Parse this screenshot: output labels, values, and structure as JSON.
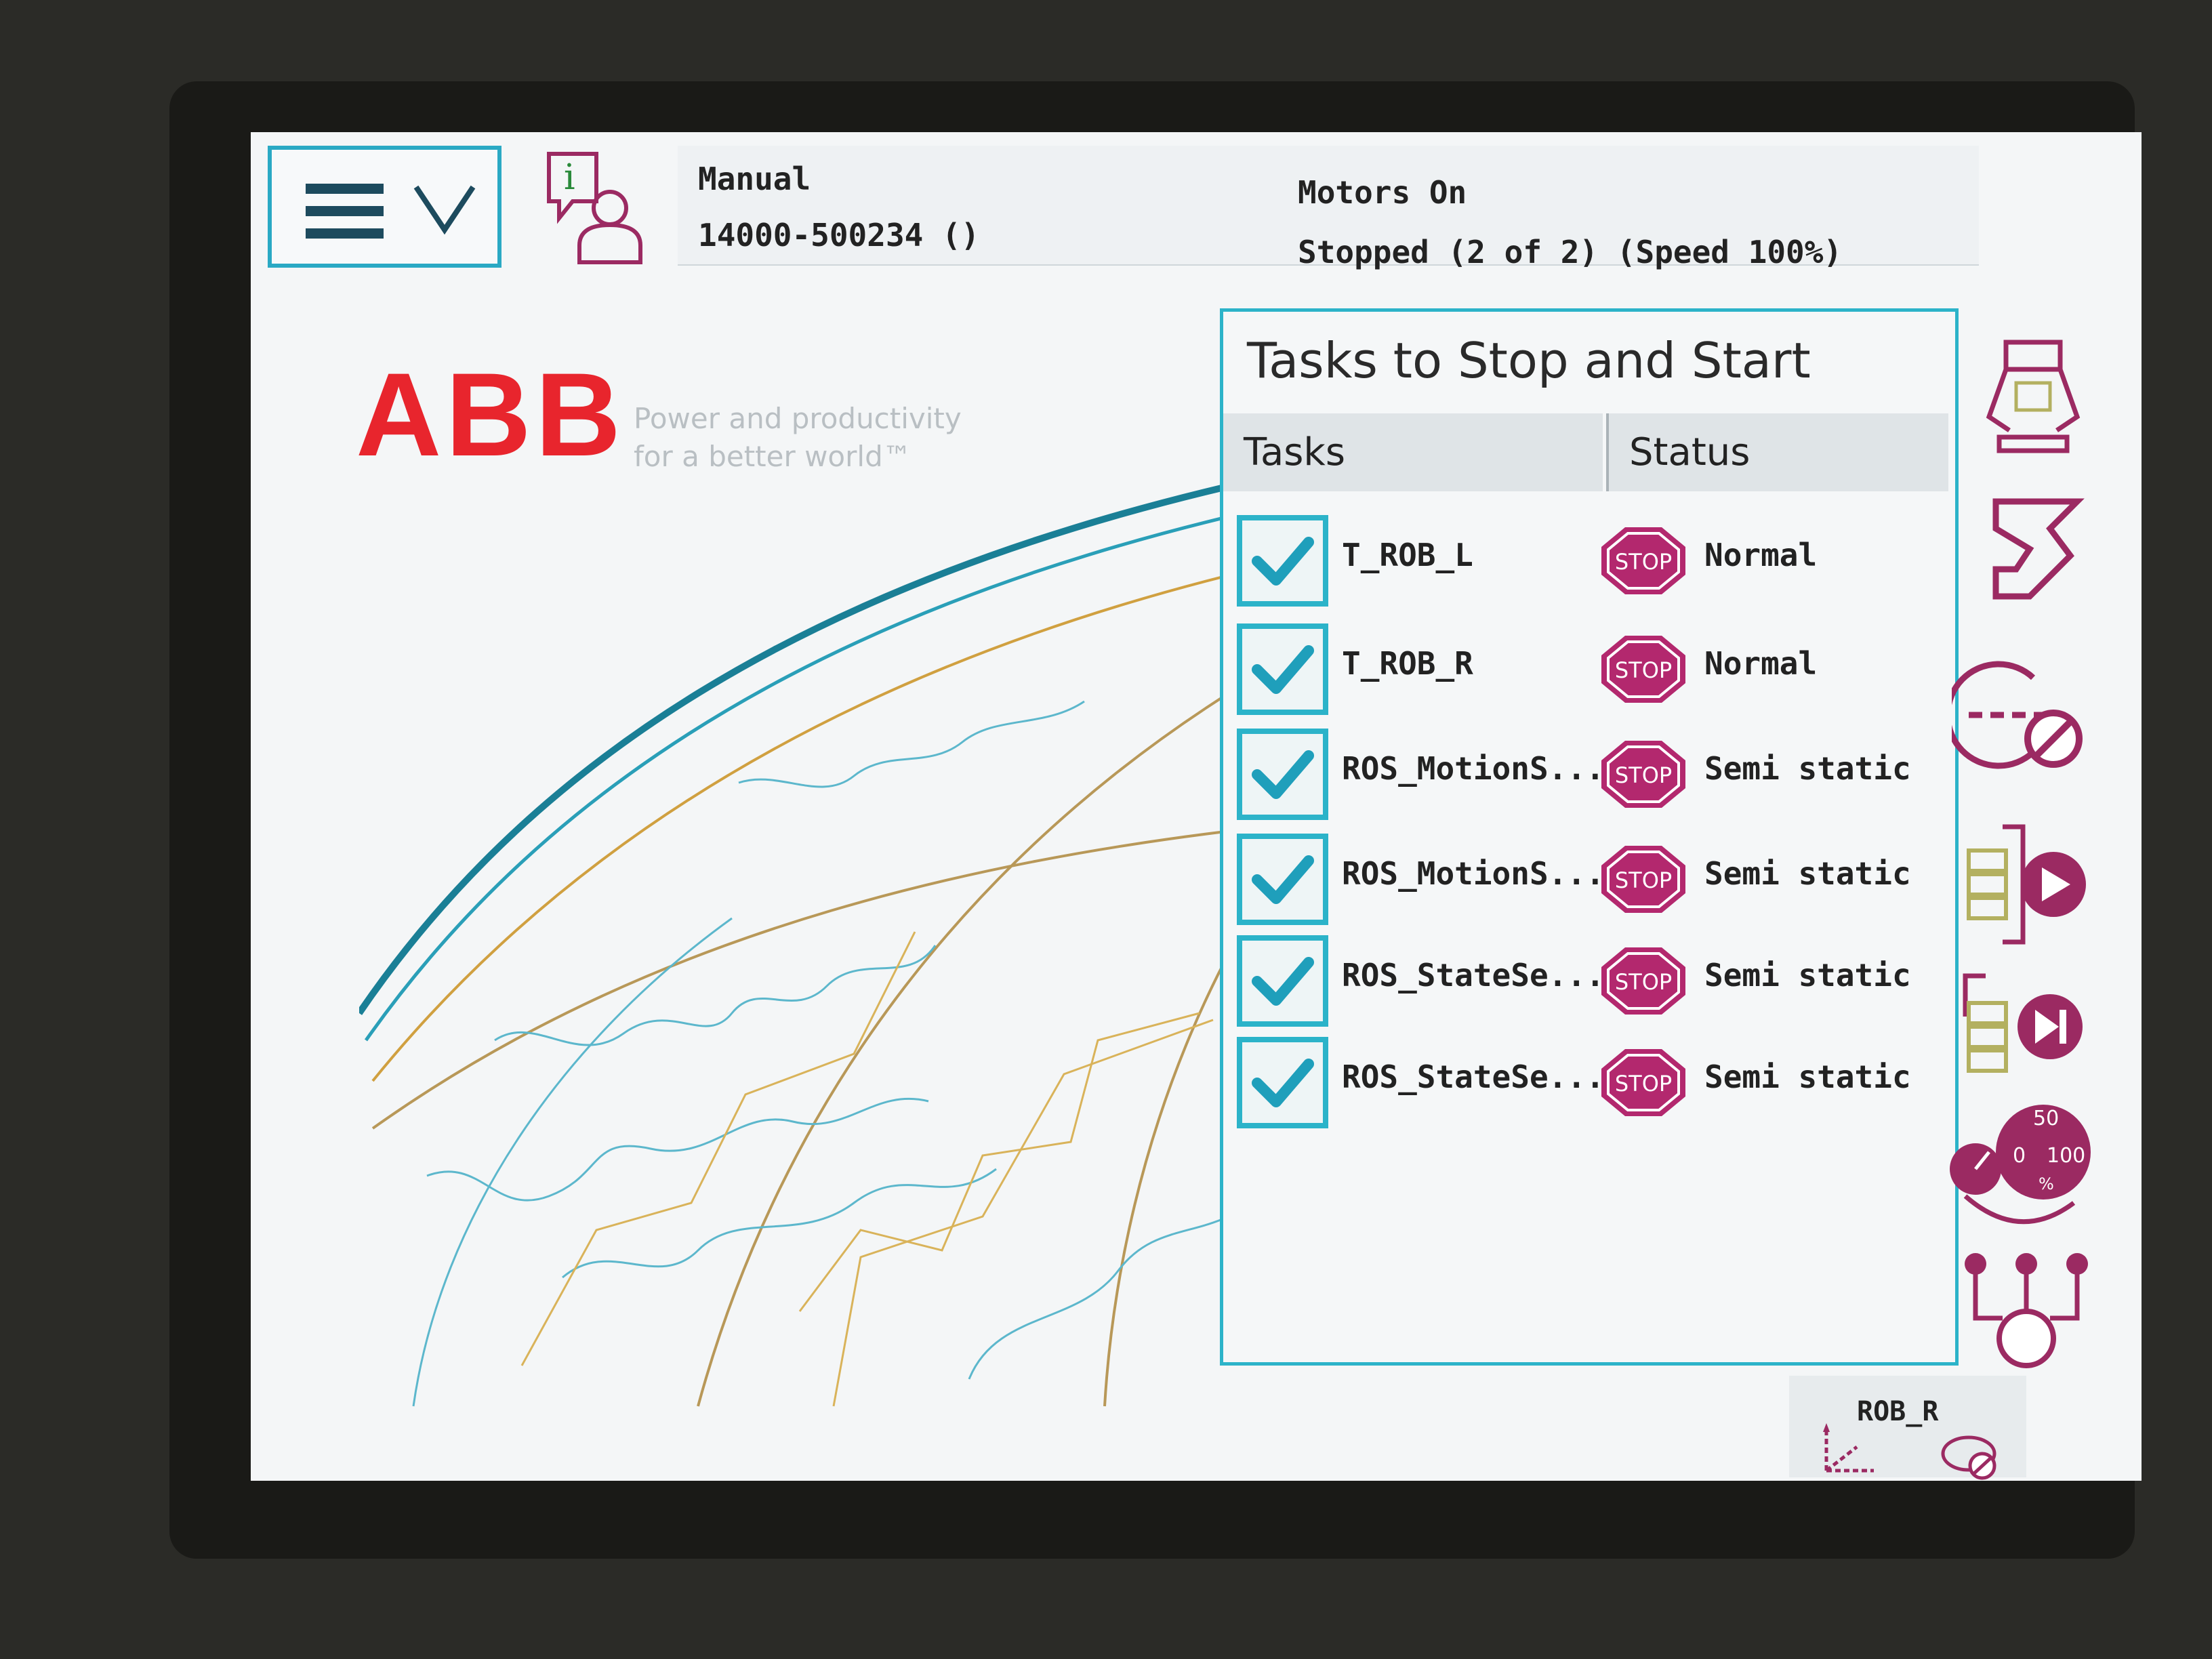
{
  "header": {
    "mode": "Manual",
    "system_id": "14000-500234 ()",
    "motors": "Motors On",
    "state": "Stopped (2 of 2) (Speed 100%)"
  },
  "branding": {
    "logo": "ABB",
    "tagline_line1": "Power and productivity",
    "tagline_line2": "for a better world™"
  },
  "dialog": {
    "title": "Tasks to Stop and Start",
    "col_tasks": "Tasks",
    "col_status": "Status",
    "rows": [
      {
        "task": "T_ROB_L",
        "stop": "STOP",
        "status": "Normal",
        "checked": true
      },
      {
        "task": "T_ROB_R",
        "stop": "STOP",
        "status": "Normal",
        "checked": true
      },
      {
        "task": "ROS_MotionS...",
        "stop": "STOP",
        "status": "Semi static",
        "checked": true
      },
      {
        "task": "ROS_MotionS...",
        "stop": "STOP",
        "status": "Semi static",
        "checked": true
      },
      {
        "task": "ROS_StateSe...",
        "stop": "STOP",
        "status": "Semi static",
        "checked": true
      },
      {
        "task": "ROS_StateSe...",
        "stop": "STOP",
        "status": "Semi static",
        "checked": true
      }
    ]
  },
  "footer": {
    "active_unit": "ROB_R"
  },
  "speed_icon": {
    "left_label": "0",
    "top_label": "50",
    "right_label": "100",
    "unit": "%"
  },
  "colors": {
    "accent": "#2cb3c9",
    "stop": "#b3286e",
    "abb_red": "#e8252d"
  }
}
